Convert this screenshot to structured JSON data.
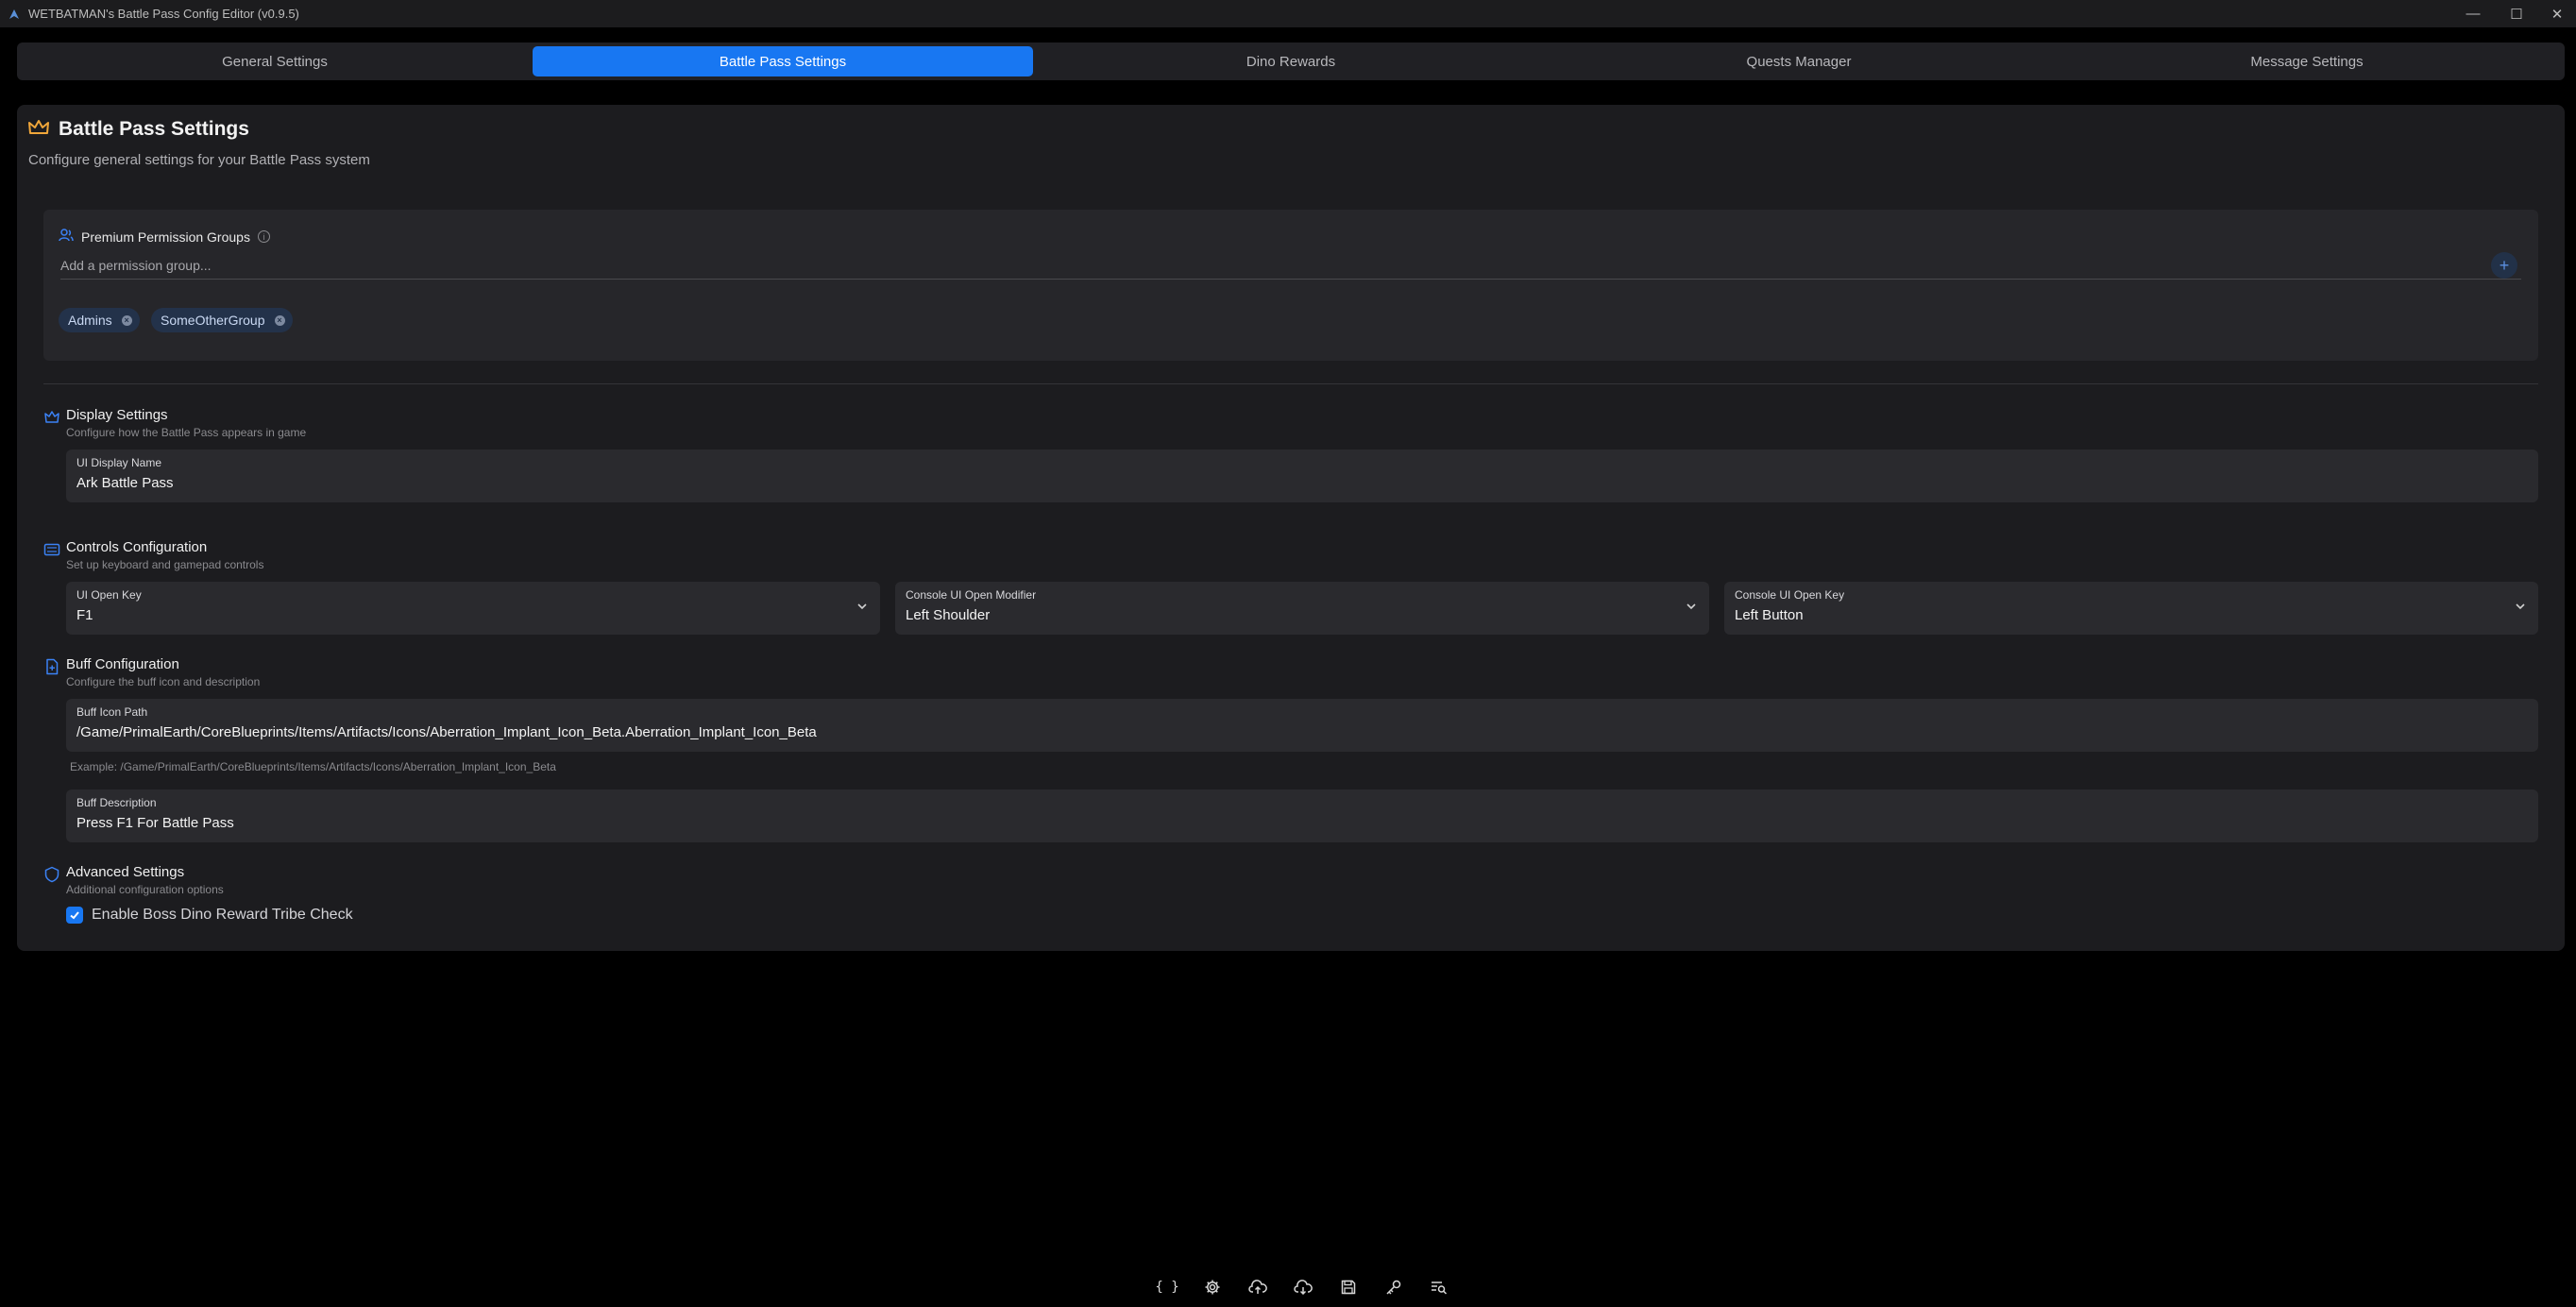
{
  "window": {
    "title": "WETBATMAN's Battle Pass Config Editor (v0.9.5)",
    "controls": {
      "minimize": "—",
      "maximize": "☐",
      "close": "✕"
    }
  },
  "tabs": [
    {
      "label": "General Settings",
      "active": false
    },
    {
      "label": "Battle Pass Settings",
      "active": true
    },
    {
      "label": "Dino Rewards",
      "active": false
    },
    {
      "label": "Quests Manager",
      "active": false
    },
    {
      "label": "Message Settings",
      "active": false
    }
  ],
  "page": {
    "title": "Battle Pass Settings",
    "subtitle": "Configure general settings for your Battle Pass system",
    "title_icon": "crown-icon"
  },
  "permission_groups": {
    "label": "Premium Permission Groups",
    "placeholder": "Add a permission group...",
    "add_button": "+",
    "groups": [
      "Admins",
      "SomeOtherGroup"
    ]
  },
  "display_settings": {
    "title": "Display Settings",
    "subtitle": "Configure how the Battle Pass appears in game",
    "ui_display_name": {
      "label": "UI Display Name",
      "value": "Ark Battle Pass"
    }
  },
  "controls": {
    "title": "Controls Configuration",
    "subtitle": "Set up keyboard and gamepad controls",
    "ui_open_key": {
      "label": "UI Open Key",
      "value": "F1"
    },
    "console_modifier": {
      "label": "Console UI Open Modifier",
      "value": "Left Shoulder"
    },
    "console_key": {
      "label": "Console UI Open Key",
      "value": "Left Button"
    }
  },
  "buff": {
    "title": "Buff Configuration",
    "subtitle": "Configure the buff icon and description",
    "icon_path": {
      "label": "Buff Icon Path",
      "value": "/Game/PrimalEarth/CoreBlueprints/Items/Artifacts/Icons/Aberration_Implant_Icon_Beta.Aberration_Implant_Icon_Beta"
    },
    "icon_path_hint": "Example: /Game/PrimalEarth/CoreBlueprints/Items/Artifacts/Icons/Aberration_Implant_Icon_Beta",
    "description": {
      "label": "Buff Description",
      "value": "Press F1 For Battle Pass"
    }
  },
  "advanced": {
    "title": "Advanced Settings",
    "subtitle": "Additional configuration options",
    "boss_check": {
      "label": "Enable Boss Dino Reward Tribe Check",
      "checked": true
    }
  },
  "toolbar": {
    "icons": [
      "json-braces-icon",
      "gear-icon",
      "cloud-upload-icon",
      "cloud-download-icon",
      "save-icon",
      "key-icon",
      "search-list-icon"
    ],
    "braces_label": "{ }"
  },
  "colors": {
    "accent": "#1877f2",
    "background": "#000000",
    "panel": "#1c1c1f",
    "crown": "#f0a63a"
  }
}
